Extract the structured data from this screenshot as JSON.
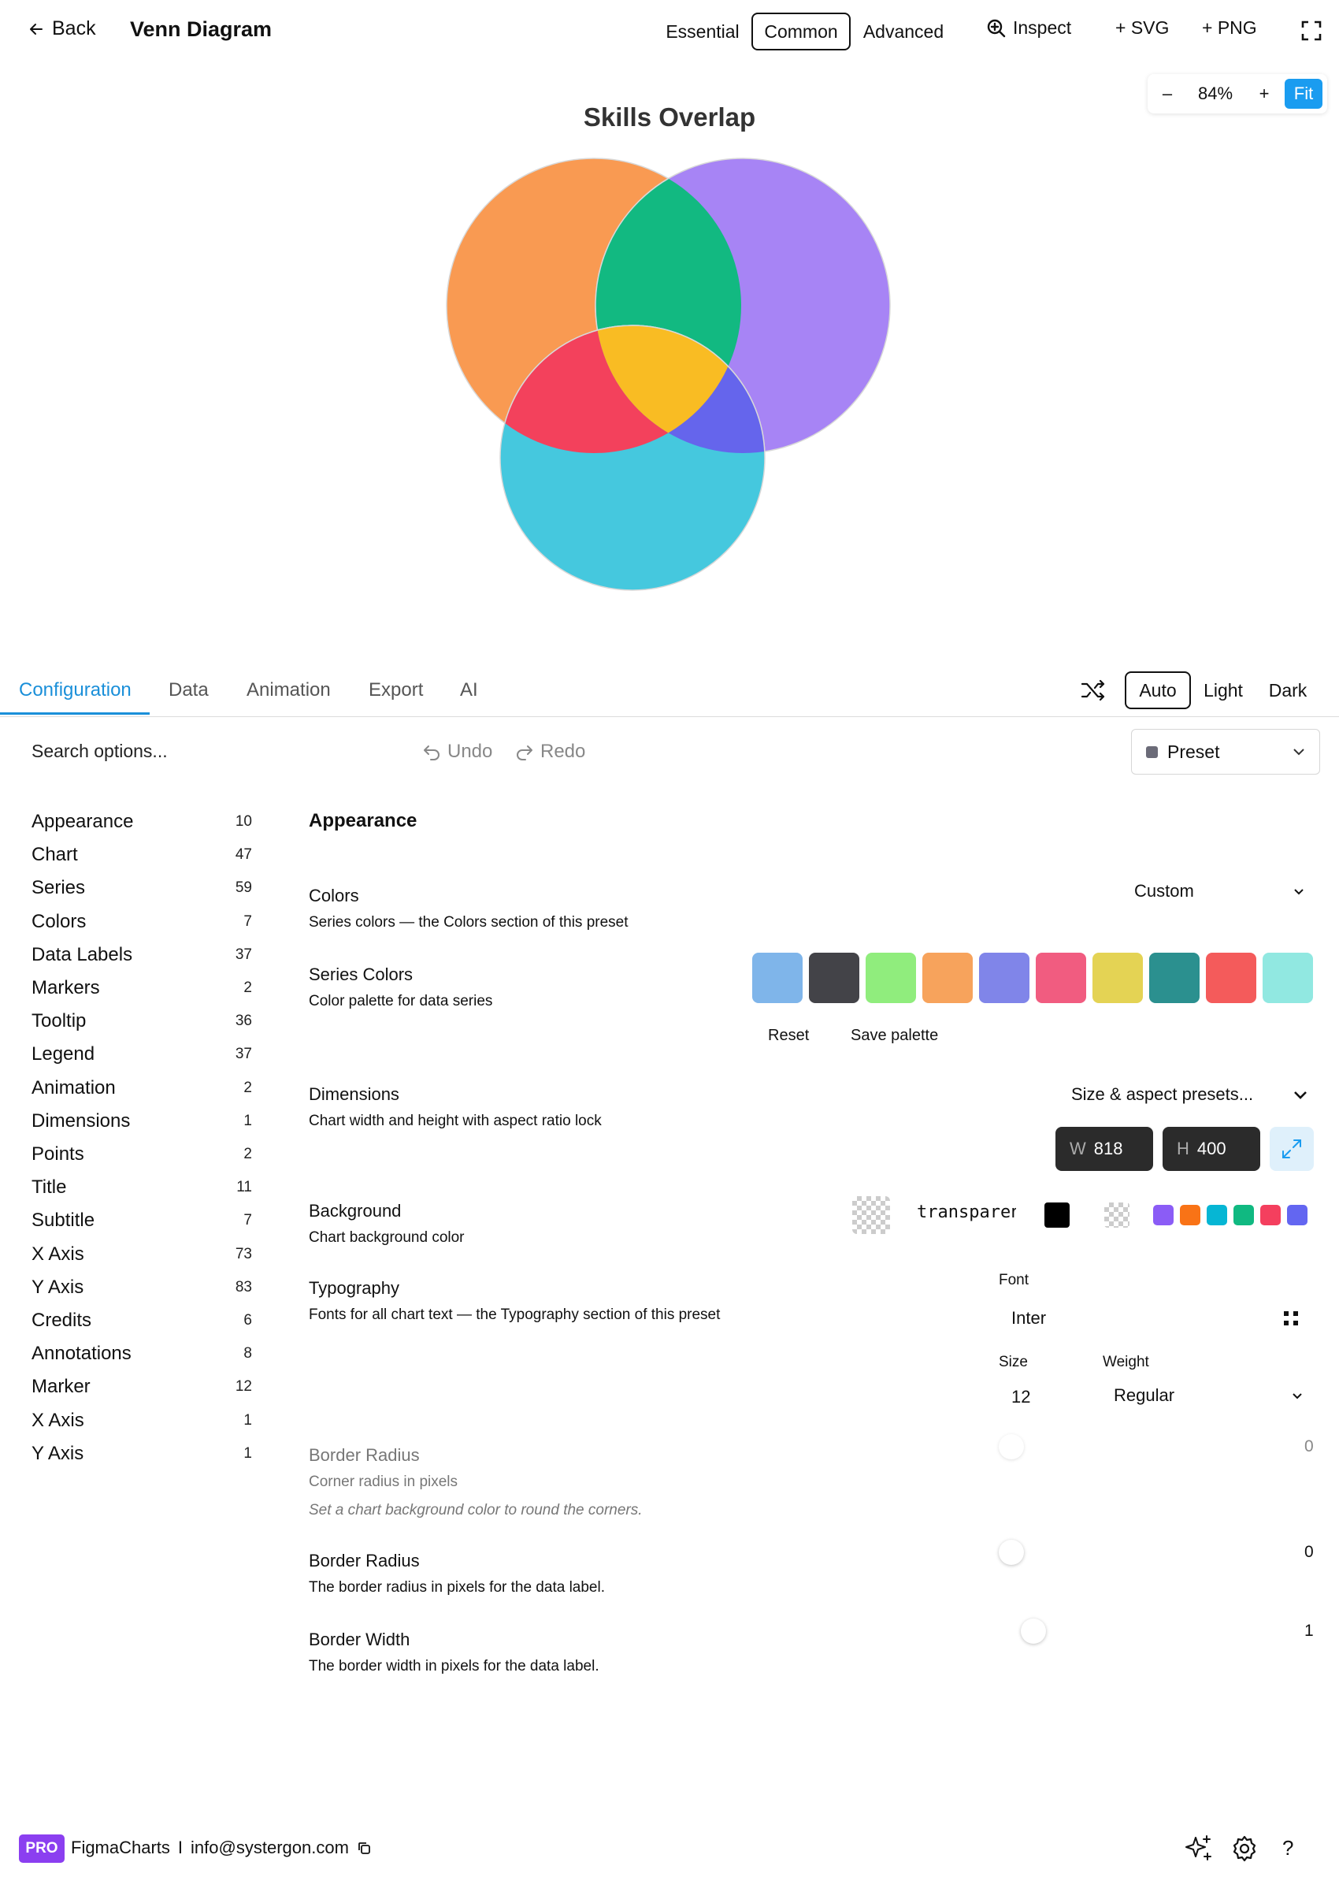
{
  "header": {
    "back_label": "Back",
    "title": "Venn Diagram",
    "modes": [
      "Essential",
      "Common",
      "Advanced"
    ],
    "active_mode": "Common",
    "inspect_label": "Inspect",
    "svg_label": "+ SVG",
    "png_label": "+ PNG"
  },
  "zoom": {
    "minus": "–",
    "level": "84%",
    "plus": "+",
    "fit": "Fit"
  },
  "chart": {
    "title": "Skills Overlap",
    "sets": [
      {
        "color": "#f99a52"
      },
      {
        "color": "#a784f5"
      },
      {
        "color": "#45c8de"
      }
    ],
    "overlap_colors": {
      "ab": "#12b981",
      "ac": "#f3415c",
      "bc": "#6565ec",
      "abc": "#f9bc23"
    }
  },
  "tabs": {
    "items": [
      "Configuration",
      "Data",
      "Animation",
      "Export",
      "AI"
    ],
    "active": "Configuration",
    "themes": [
      "Auto",
      "Light",
      "Dark"
    ],
    "active_theme": "Auto"
  },
  "toolbar": {
    "search_placeholder": "Search options...",
    "undo": "Undo",
    "redo": "Redo",
    "preset": "Preset"
  },
  "nav": [
    {
      "label": "Appearance",
      "count": "10"
    },
    {
      "label": "Chart",
      "count": "47"
    },
    {
      "label": "Series",
      "count": "59"
    },
    {
      "label": "Colors",
      "count": "7"
    },
    {
      "label": "Data Labels",
      "count": "37"
    },
    {
      "label": "Markers",
      "count": "2"
    },
    {
      "label": "Tooltip",
      "count": "36"
    },
    {
      "label": "Legend",
      "count": "37"
    },
    {
      "label": "Animation",
      "count": "2"
    },
    {
      "label": "Dimensions",
      "count": "1"
    },
    {
      "label": "Points",
      "count": "2"
    },
    {
      "label": "Title",
      "count": "11"
    },
    {
      "label": "Subtitle",
      "count": "7"
    },
    {
      "label": "X Axis",
      "count": "73"
    },
    {
      "label": "Y Axis",
      "count": "83"
    },
    {
      "label": "Credits",
      "count": "6"
    },
    {
      "label": "Annotations",
      "count": "8"
    },
    {
      "label": "Marker",
      "count": "12"
    },
    {
      "label": "X Axis",
      "count": "1"
    },
    {
      "label": "Y Axis",
      "count": "1"
    }
  ],
  "content": {
    "section": "Appearance",
    "colors": {
      "title": "Colors",
      "desc": "Series colors — the Colors section of this preset",
      "value": "Custom"
    },
    "series_colors": {
      "title": "Series Colors",
      "desc": "Color palette for data series",
      "palette": [
        "#7fb5ea",
        "#434348",
        "#90ed7d",
        "#f7a35c",
        "#8085e9",
        "#f15c80",
        "#e4d354",
        "#2b908f",
        "#f45b5b",
        "#91e8e1"
      ],
      "reset": "Reset",
      "save": "Save palette"
    },
    "dimensions": {
      "title": "Dimensions",
      "desc": "Chart width and height with aspect ratio lock",
      "presets": "Size & aspect presets...",
      "w_label": "W",
      "w": "818",
      "h_label": "H",
      "h": "400"
    },
    "background": {
      "title": "Background",
      "desc": "Chart background color",
      "value": "transparent",
      "quick": [
        "#8b5cf6",
        "#f97316",
        "#06b6d4",
        "#10b981",
        "#f43f5e",
        "#6366f1"
      ]
    },
    "typography": {
      "title": "Typography",
      "desc": "Fonts for all chart text — the Typography section of this preset",
      "font_label": "Font",
      "font": "Inter",
      "size_label": "Size",
      "size": "12",
      "weight_label": "Weight",
      "weight": "Regular"
    },
    "border_radius_disabled": {
      "title": "Border Radius",
      "desc": "Corner radius in pixels",
      "hint": "Set a chart background color to round the corners.",
      "value": "0"
    },
    "border_radius": {
      "title": "Border Radius",
      "desc": "The border radius in pixels for the data label.",
      "value": "0"
    },
    "border_width": {
      "title": "Border Width",
      "desc": "The border width in pixels for the data label.",
      "value": "1"
    }
  },
  "footer": {
    "badge": "PRO",
    "brand": "FigmaCharts",
    "separator": "I",
    "email": "info@systergon.com",
    "help": "?"
  }
}
